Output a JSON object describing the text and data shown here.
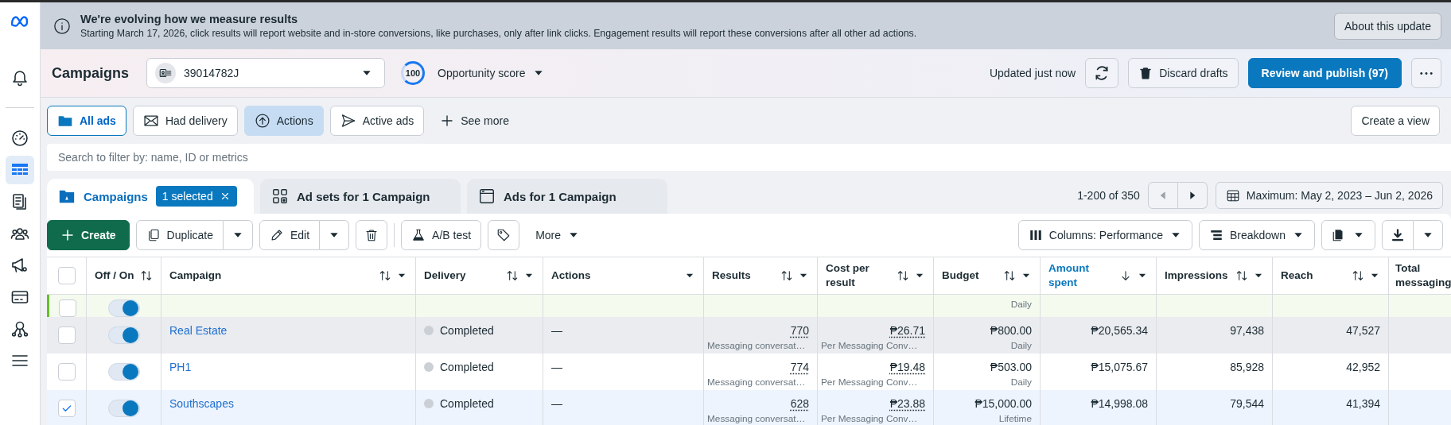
{
  "sidebar": {
    "items": [
      {
        "selected": false
      },
      {
        "selected": false
      },
      {
        "selected": true
      },
      {
        "selected": false
      },
      {
        "selected": false
      },
      {
        "selected": false
      },
      {
        "selected": false
      },
      {
        "selected": false
      },
      {
        "selected": false
      }
    ]
  },
  "banner": {
    "title": "We're evolving how we measure results",
    "text": "Starting March 17, 2026, click results will report website and in-store conversions, like purchases, only after link clicks. Engagement results will report these conversions after all other ad actions.",
    "button": "About this update"
  },
  "header": {
    "title": "Campaigns",
    "account": "39014782J",
    "score": "100",
    "score_label": "Opportunity score",
    "updated": "Updated just now",
    "discard": "Discard drafts",
    "publish": "Review and publish (97)"
  },
  "filters": [
    {
      "label": "All ads",
      "selected": true,
      "highlighted": false
    },
    {
      "label": "Had delivery",
      "selected": false,
      "highlighted": false
    },
    {
      "label": "Actions",
      "selected": false,
      "highlighted": true
    },
    {
      "label": "Active ads",
      "selected": false,
      "highlighted": false
    }
  ],
  "see_more": "See more",
  "create_view": "Create a view",
  "search": {
    "placeholder": "Search to filter by: name, ID or metrics"
  },
  "tabs": [
    {
      "label": "Campaigns",
      "selected": true,
      "badge": "1 selected"
    },
    {
      "label": "Ad sets for 1 Campaign",
      "selected": false
    },
    {
      "label": "Ads for 1 Campaign",
      "selected": false
    }
  ],
  "pagination": {
    "range": "1-200 of 350",
    "prev_disabled": true
  },
  "date_range": "Maximum: May 2, 2023 – Jun 2, 2026",
  "toolbar": {
    "create": "Create",
    "duplicate": "Duplicate",
    "edit": "Edit",
    "ab_test": "A/B test",
    "more": "More",
    "columns": "Columns: Performance",
    "breakdown": "Breakdown"
  },
  "table": {
    "select_all": {
      "checked": false
    },
    "columns": [
      {
        "label": "Off / On",
        "sortable": true,
        "sorted": false,
        "menu": false
      },
      {
        "label": "Campaign",
        "sortable": true,
        "sorted": false,
        "menu": true
      },
      {
        "label": "Delivery",
        "sortable": true,
        "sorted": false,
        "menu": true
      },
      {
        "label": "Actions",
        "sortable": false,
        "sorted": false,
        "menu": true
      },
      {
        "label": "Results",
        "sortable": true,
        "sorted": false,
        "menu": true
      },
      {
        "label": "Cost per result",
        "sortable": true,
        "sorted": false,
        "menu": true
      },
      {
        "label": "Budget",
        "sortable": true,
        "sorted": false,
        "menu": true
      },
      {
        "label": "Amount spent",
        "sortable": true,
        "sorted": true,
        "menu": true
      },
      {
        "label": "Impressions",
        "sortable": true,
        "sorted": false,
        "menu": true
      },
      {
        "label": "Reach",
        "sortable": true,
        "sorted": false,
        "menu": true
      },
      {
        "label": "Total messaging",
        "sortable": false,
        "sorted": false,
        "menu": false
      }
    ],
    "rows": [
      {
        "kind": "draft",
        "checked": false,
        "hovered": false,
        "on": true,
        "budget_period": "Daily"
      },
      {
        "kind": "campaign",
        "checked": false,
        "hovered": true,
        "on": true,
        "campaign": "Real Estate",
        "delivery": "Completed",
        "color": "#cbd0d6",
        "actions": "—",
        "results": "770",
        "results_label": "Messaging conversat…",
        "cost": "₱26.71",
        "cost_label": "Per Messaging Conv…",
        "budget": "₱800.00",
        "budget_period": "Daily",
        "amount_spent": "₱20,565.34",
        "impressions": "97,438",
        "reach": "47,527"
      },
      {
        "kind": "campaign",
        "checked": false,
        "hovered": false,
        "on": true,
        "campaign": "PH1",
        "delivery": "Completed",
        "color": "#cbd0d6",
        "actions": "—",
        "results": "774",
        "results_label": "Messaging conversat…",
        "cost": "₱19.48",
        "cost_label": "Per Messaging Conv…",
        "budget": "₱503.00",
        "budget_period": "Daily",
        "amount_spent": "₱15,075.67",
        "impressions": "85,928",
        "reach": "42,952"
      },
      {
        "kind": "campaign",
        "checked": true,
        "hovered": false,
        "on": true,
        "campaign": "Southscapes",
        "delivery": "Completed",
        "color": "#cbd0d6",
        "actions": "—",
        "results": "628",
        "results_label": "Messaging conversat…",
        "cost": "₱23.88",
        "cost_label": "Per Messaging Conv…",
        "budget": "₱15,000.00",
        "budget_period": "Lifetime",
        "amount_spent": "₱14,998.08",
        "impressions": "79,544",
        "reach": "41,394"
      }
    ]
  }
}
